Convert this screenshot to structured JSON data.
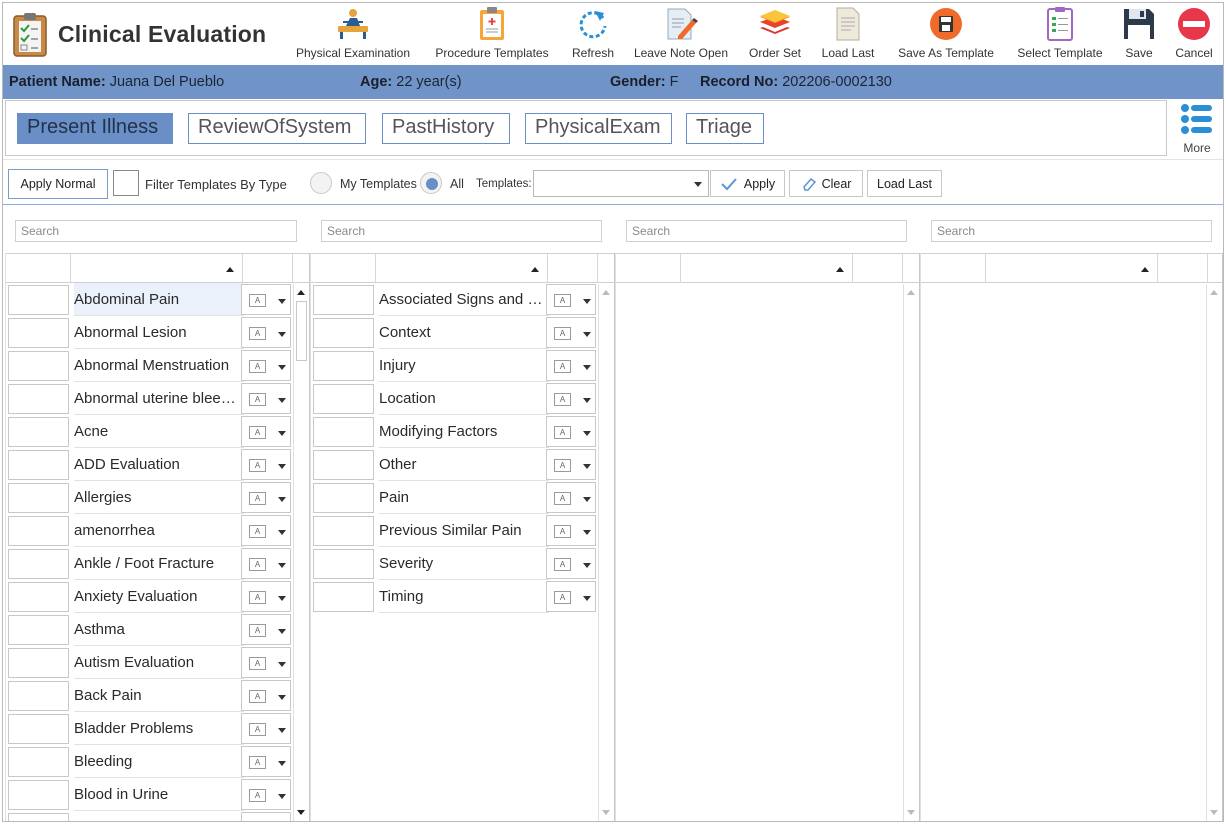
{
  "app": {
    "title": "Clinical Evaluation"
  },
  "toolbar": [
    {
      "label": "Physical Examination",
      "icon": "physical-exam-icon"
    },
    {
      "label": "Procedure Templates",
      "icon": "clipboard-icon"
    },
    {
      "label": "Refresh",
      "icon": "refresh-icon"
    },
    {
      "label": "Leave Note Open",
      "icon": "note-pencil-icon"
    },
    {
      "label": "Order Set",
      "icon": "layers-icon"
    },
    {
      "label": "Load Last",
      "icon": "document-icon"
    },
    {
      "label": "Save As Template",
      "icon": "save-circle-icon"
    },
    {
      "label": "Select Template",
      "icon": "checklist-icon"
    },
    {
      "label": "Save",
      "icon": "floppy-icon"
    },
    {
      "label": "Cancel",
      "icon": "cancel-icon"
    }
  ],
  "patient": {
    "name_label": "Patient Name:",
    "name": "Juana Del Pueblo",
    "age_label": "Age:",
    "age": "22 year(s)",
    "gender_label": "Gender:",
    "gender": "F",
    "record_label": "Record No:",
    "record": "202206-0002130"
  },
  "tabs": [
    "Present Illness",
    "ReviewOfSystem",
    "PastHistory",
    "PhysicalExam",
    "Triage"
  ],
  "active_tab": "Present Illness",
  "more_label": "More",
  "filters": {
    "apply_normal": "Apply Normal",
    "filter_by_type": "Filter Templates By Type",
    "my_templates": "My Templates",
    "all": "All",
    "templates_label": "Templates:",
    "templates_value": "",
    "apply": "Apply",
    "clear": "Clear",
    "load_last": "Load Last"
  },
  "search_placeholder": "Search",
  "grid1": {
    "items": [
      "Abdominal Pain",
      "Abnormal Lesion",
      "Abnormal Menstruation",
      "Abnormal uterine bleeding",
      "Acne",
      "ADD Evaluation",
      "Allergies",
      "amenorrhea",
      "Ankle / Foot Fracture",
      "Anxiety Evaluation",
      "Asthma",
      "Autism Evaluation",
      "Back Pain",
      "Bladder Problems",
      "Bleeding",
      "Blood in Urine"
    ],
    "selected": "Abdominal Pain"
  },
  "grid2": {
    "items": [
      "Associated Signs and Symptoms",
      "Context",
      "Injury",
      "Location",
      "Modifying Factors",
      "Other",
      "Pain",
      "Previous Similar Pain",
      "Severity",
      "Timing"
    ]
  },
  "colors": {
    "accent": "#6a8fc6",
    "patient_bar": "#7094c8"
  }
}
